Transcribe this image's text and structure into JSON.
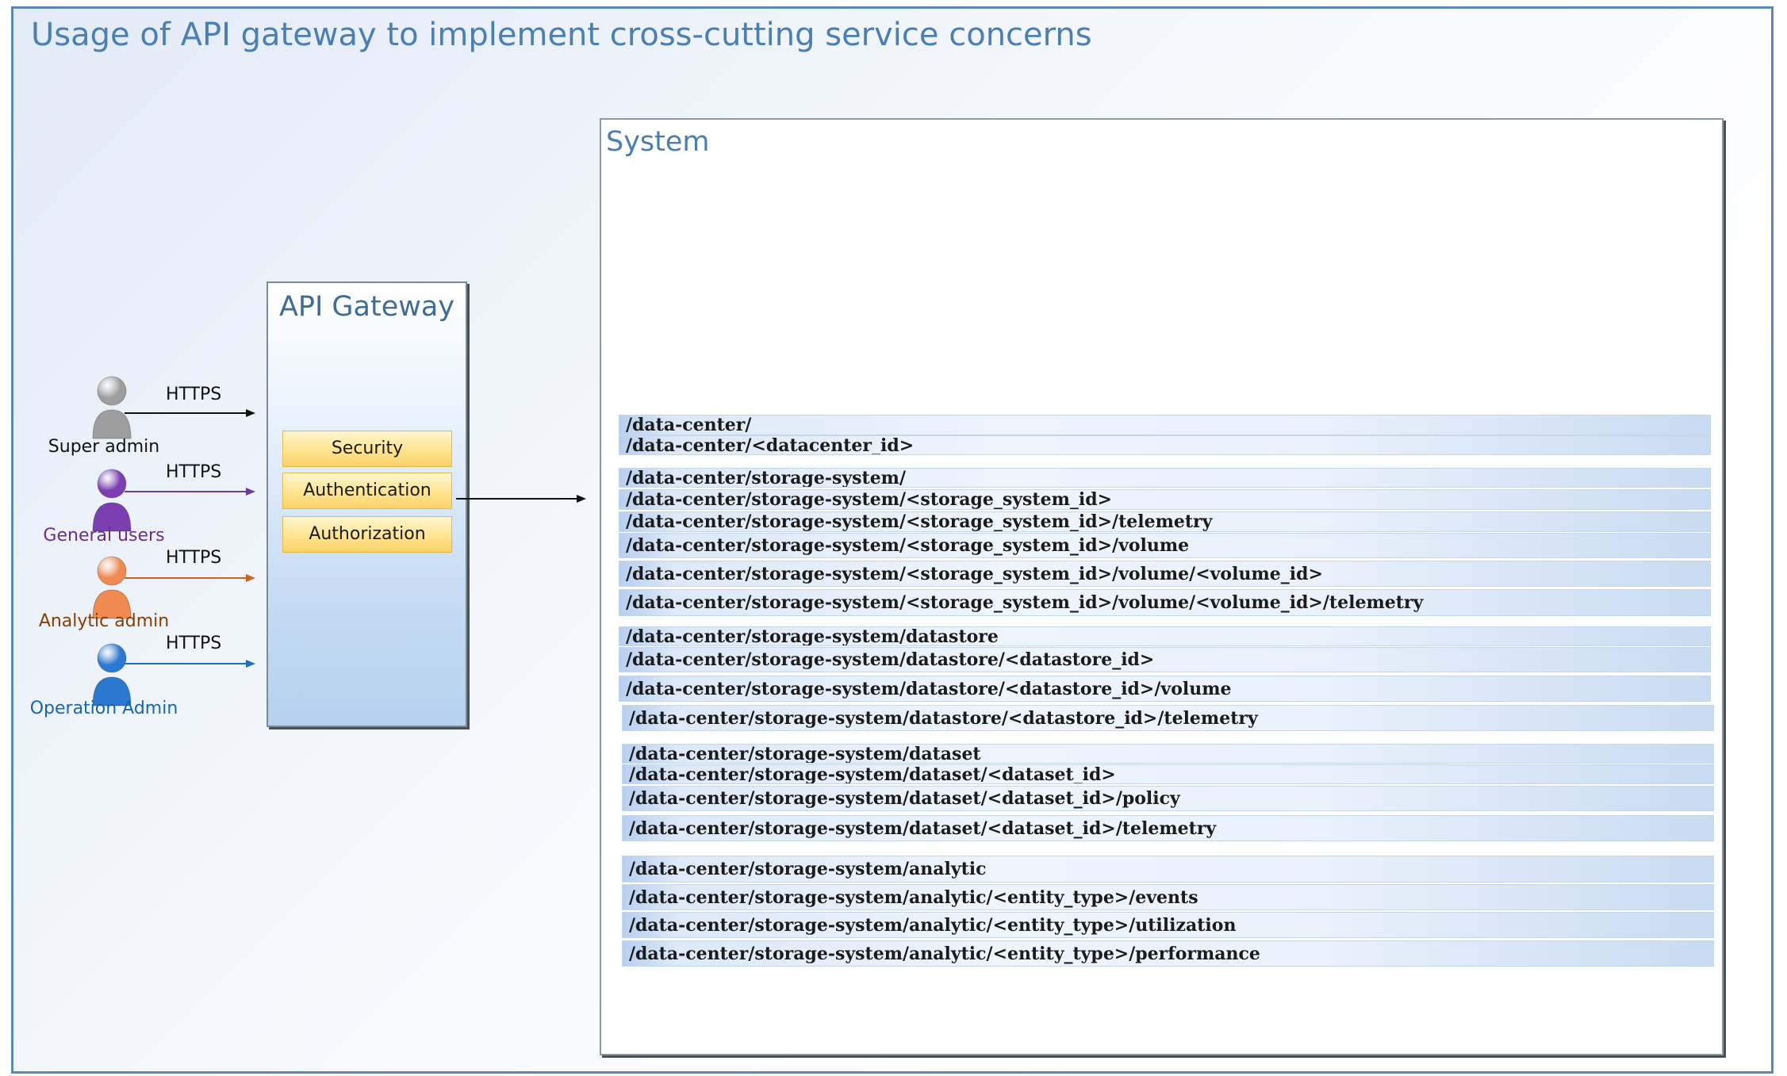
{
  "title": "Usage of API gateway to implement cross-cutting service concerns",
  "actors": [
    {
      "label": "Super admin",
      "color": "#9e9e9e",
      "label_color": "#111111",
      "link": "HTTPS",
      "line_color": "#111111"
    },
    {
      "label": "General users",
      "color": "#7b3fb1",
      "label_color": "#6a2f8f",
      "link": "HTTPS",
      "line_color": "#6a3d9a"
    },
    {
      "label": "Analytic admin",
      "color": "#f08a50",
      "label_color": "#8a3d00",
      "link": "HTTPS",
      "line_color": "#c86428"
    },
    {
      "label": "Operation Admin",
      "color": "#2a78cf",
      "label_color": "#1467b0",
      "link": "HTTPS",
      "line_color": "#1f6fb8"
    }
  ],
  "gateway": {
    "title": "API Gateway",
    "concerns": [
      "Security",
      "Authentication",
      "Authorization"
    ]
  },
  "system": {
    "title": "System",
    "routes": [
      "/data-center/",
      "/data-center/<datacenter_id>",
      "/data-center/storage-system/",
      "/data-center/storage-system/<storage_system_id>",
      "/data-center/storage-system/<storage_system_id>/telemetry",
      "/data-center/storage-system/<storage_system_id>/volume",
      "/data-center/storage-system/<storage_system_id>/volume/<volume_id>",
      "/data-center/storage-system/<storage_system_id>/volume/<volume_id>/telemetry",
      "/data-center/storage-system/datastore",
      "/data-center/storage-system/datastore/<datastore_id>",
      "/data-center/storage-system/datastore/<datastore_id>/volume",
      "/data-center/storage-system/datastore/<datastore_id>/telemetry",
      "/data-center/storage-system/dataset",
      "/data-center/storage-system/dataset/<dataset_id>",
      "/data-center/storage-system/dataset/<dataset_id>/policy",
      "/data-center/storage-system/dataset/<dataset_id>/telemetry",
      "/data-center/storage-system/analytic",
      "/data-center/storage-system/analytic/<entity_type>/events",
      "/data-center/storage-system/analytic/<entity_type>/utilization",
      "/data-center/storage-system/analytic/<entity_type>/performance"
    ]
  }
}
